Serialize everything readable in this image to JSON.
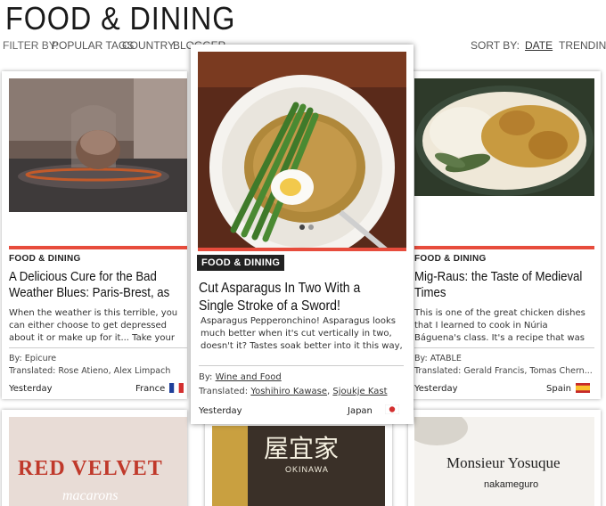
{
  "header": {
    "title": "FOOD & DINING"
  },
  "filters": {
    "label": "FILTER BY:",
    "items": [
      "POPULAR TAGS",
      "COUNTRY",
      "BLOGGER"
    ]
  },
  "sort": {
    "label": "SORT BY:",
    "items": [
      "DATE",
      "TRENDING"
    ],
    "active": "DATE"
  },
  "colors": {
    "accent": "#e74c3c",
    "category_bg": "#222222"
  },
  "cards": [
    {
      "category": "FOOD & DINING",
      "title_lines": [
        "A Delicious Cure for the Bad",
        "Weather Blues: Paris-Brest, as"
      ],
      "excerpt": "When the weather is this terrible, you can either choose to get depressed about it or make up for it... Take your pick!",
      "by_label": "By:",
      "by": "Epicure",
      "translated_label": "Translated:",
      "translated": "Rose Atieno, Alex Limpach",
      "date": "Yesterday",
      "country": "France",
      "flag_icon": "france-flag-icon"
    },
    {
      "category": "FOOD & DINING",
      "title_lines": [
        "Cut Asparagus In Two With a",
        "Single Stroke of a Sword!"
      ],
      "excerpt": "Asparagus Pepperonchino! Asparagus looks much better when it's cut vertically in two, doesn't it? Tastes soak better into it this way, and it's the",
      "by_label": "By:",
      "by": "Wine and Food",
      "translated_label": "Translated:",
      "translated_1": "Yoshihiro Kawase",
      "translated_sep": ", ",
      "translated_2": "Sjoukje Kast",
      "date": "Yesterday",
      "country": "Japan",
      "flag_icon": "japan-flag-icon"
    },
    {
      "category": "FOOD & DINING",
      "title_lines": [
        "Mig-Raus: the Taste of Medieval",
        "Times"
      ],
      "excerpt": "This is one of the great chicken dishes that I learned to cook in Núria Báguena's class. It's a recipe that was even",
      "by_label": "By:",
      "by": "ATABLE",
      "translated_label": "Translated:",
      "translated": "Gerald Francis, Tomas Chern...",
      "date": "Yesterday",
      "country": "Spain",
      "flag_icon": "spain-flag-icon"
    }
  ],
  "bottom_cards": [
    {
      "text_1": "RED VELVET",
      "text_2": "macarons"
    },
    {
      "text_1": "屋宜家",
      "text_2": "OKINAWA"
    },
    {
      "text_1": "Monsieur Yosuque",
      "text_2": "nakameguro"
    }
  ]
}
